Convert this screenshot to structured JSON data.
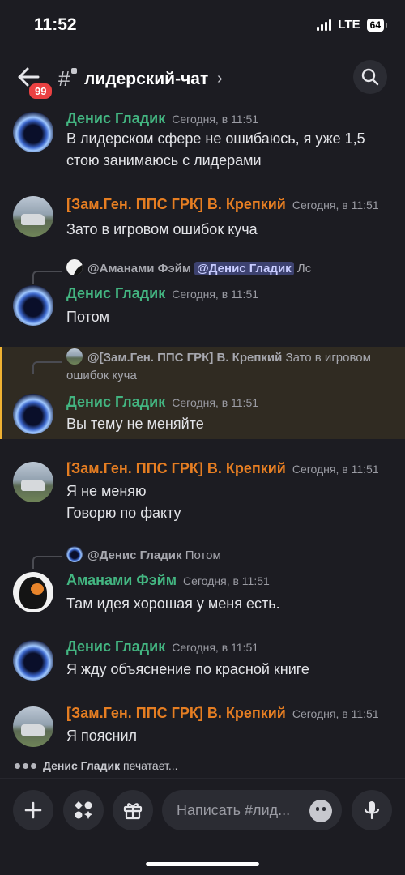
{
  "status_bar": {
    "time": "11:52",
    "network": "LTE",
    "battery": "64"
  },
  "header": {
    "unread_badge": "99",
    "channel_name": "лидерский-чат",
    "chevron": "›"
  },
  "messages": [
    {
      "author": "Денис Гладик",
      "timestamp": "Сегодня, в 11:51",
      "lines": [
        "В лидерском сфере не ошибаюсь, я уже 1,5",
        "стою занимаюсь с лидерами"
      ]
    },
    {
      "author": "[Зам.Ген. ППС ГРК] В. Крепкий",
      "timestamp": "Сегодня, в 11:51",
      "lines": [
        "Зато в игровом ошибок куча"
      ]
    },
    {
      "reply_to": "@Аманами Фэйм",
      "reply_mention": "@Денис Гладик",
      "reply_text": "Лс",
      "author": "Денис Гладик",
      "timestamp": "Сегодня, в 11:51",
      "lines": [
        "Потом"
      ]
    },
    {
      "reply_to": "@[Зам.Ген. ППС ГРК] В. Крепкий",
      "reply_text": "Зато в игровом ошибок куча",
      "author": "Денис Гладик",
      "timestamp": "Сегодня, в 11:51",
      "lines": [
        "Вы тему не меняйте"
      ]
    },
    {
      "author": "[Зам.Ген. ППС ГРК] В. Крепкий",
      "timestamp": "Сегодня, в 11:51",
      "lines": [
        "Я не меняю",
        "Говорю по факту"
      ]
    },
    {
      "reply_to": "@Денис Гладик",
      "reply_text": "Потом",
      "author": "Аманами Фэйм",
      "timestamp": "Сегодня, в 11:51",
      "lines": [
        "Там идея хорошая у меня есть."
      ]
    },
    {
      "author": "Денис Гладик",
      "timestamp": "Сегодня, в 11:51",
      "lines": [
        "Я жду объяснение по красной книге"
      ]
    },
    {
      "author": "[Зам.Ген. ППС ГРК] В. Крепкий",
      "timestamp": "Сегодня, в 11:51",
      "lines": [
        "Я пояснил"
      ]
    }
  ],
  "typing": {
    "user": "Денис Гладик",
    "suffix": "печатает..."
  },
  "composer": {
    "placeholder": "Написать #лид..."
  },
  "colors": {
    "background": "#1c1c22",
    "green_name": "#43b581",
    "orange_name": "#e67e22",
    "highlight_border": "#f0b232",
    "badge": "#ea4142"
  },
  "icons": [
    "back-arrow-icon",
    "hash-icon",
    "search-icon",
    "plus-icon",
    "apps-icon",
    "gift-icon",
    "emoji-icon",
    "mic-icon"
  ]
}
